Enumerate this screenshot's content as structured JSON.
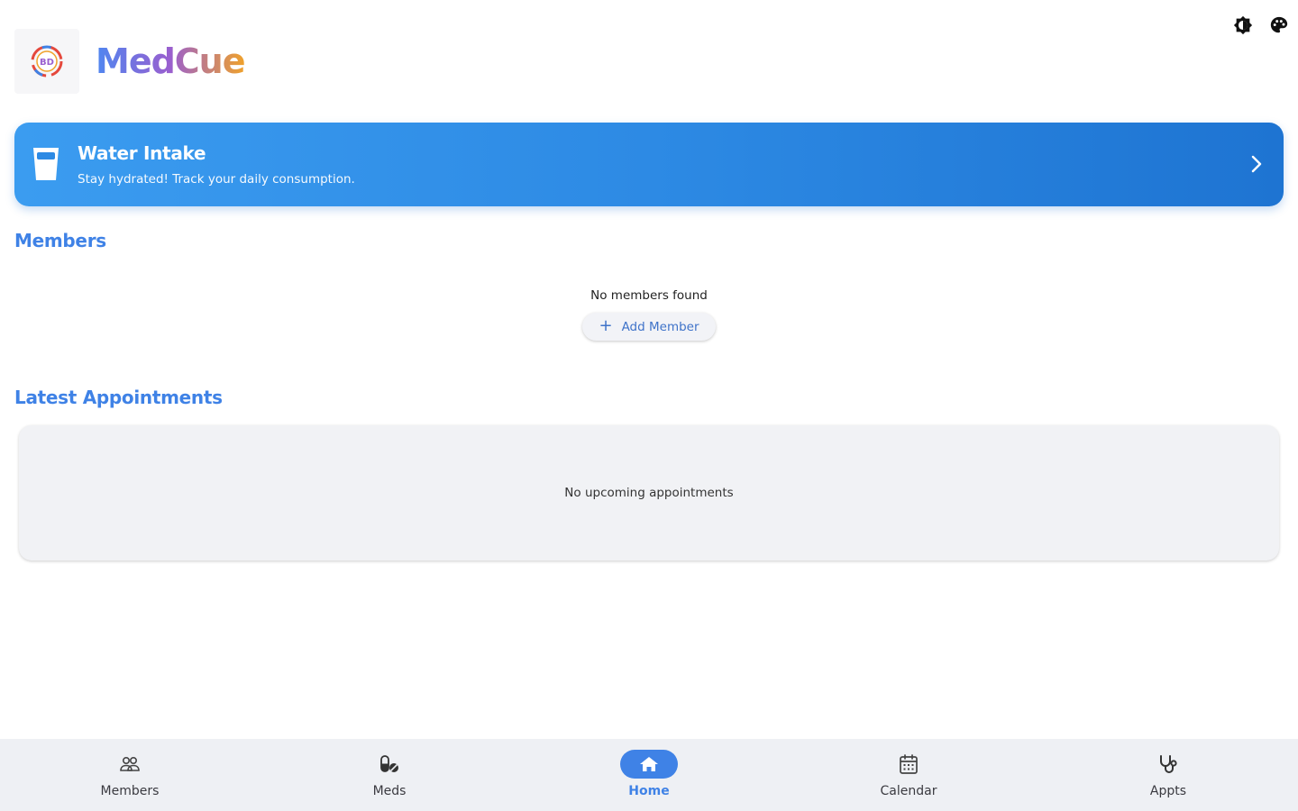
{
  "header": {
    "app_title": "MedCue",
    "logo_text": "BD"
  },
  "top_actions": {
    "icons": [
      "brightness-icon",
      "palette-icon"
    ]
  },
  "water_banner": {
    "title": "Water Intake",
    "subtitle": "Stay hydrated! Track your daily consumption."
  },
  "members": {
    "title": "Members",
    "empty_text": "No members found",
    "add_label": "Add Member"
  },
  "appointments": {
    "title": "Latest Appointments",
    "empty_text": "No upcoming appointments"
  },
  "bottom_nav": {
    "items": [
      {
        "label": "Members",
        "icon": "people-icon"
      },
      {
        "label": "Meds",
        "icon": "pill-icon"
      },
      {
        "label": "Home",
        "icon": "home-icon",
        "active": true
      },
      {
        "label": "Calendar",
        "icon": "calendar-icon"
      },
      {
        "label": "Appts",
        "icon": "stethoscope-icon"
      }
    ]
  },
  "colors": {
    "accent": "#3f82e6",
    "banner_start": "#3b9cf0",
    "banner_end": "#1e74d2",
    "nav_bg": "#eef0f4"
  }
}
